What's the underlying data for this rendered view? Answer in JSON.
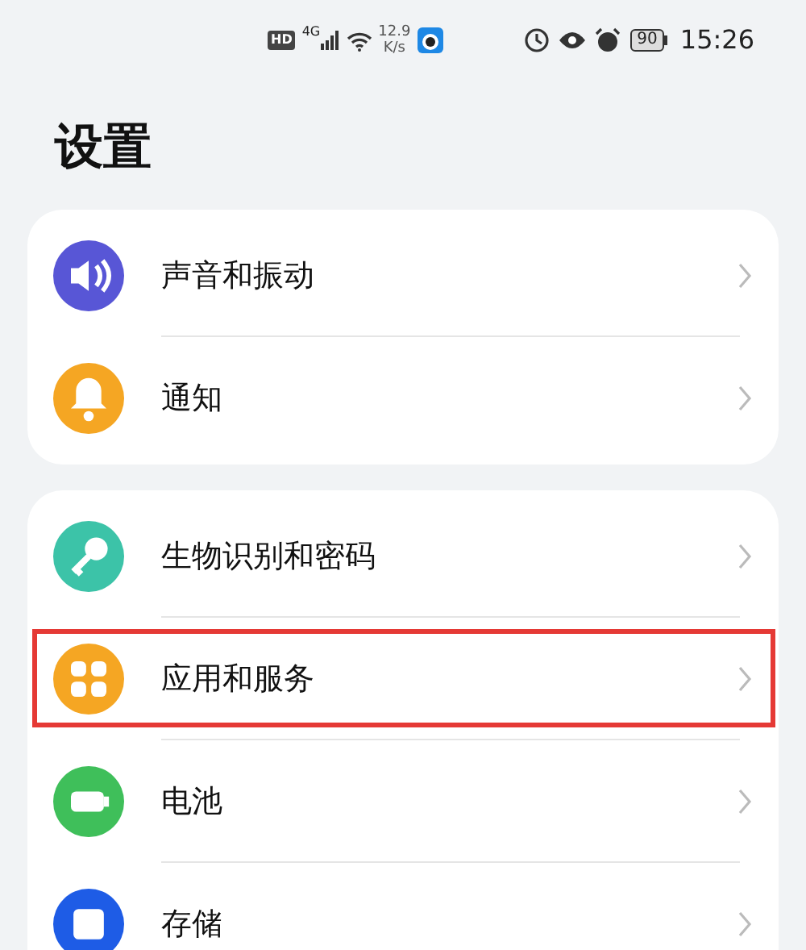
{
  "status_bar": {
    "hd": "HD",
    "network": "4G",
    "speed_value": "12.9",
    "speed_unit": "K/s",
    "battery": "90",
    "time": "15:26"
  },
  "title": "设置",
  "groups": [
    {
      "items": [
        {
          "label": "声音和振动",
          "kind": "sound",
          "color": "#5856d6",
          "highlighted": false
        },
        {
          "label": "通知",
          "kind": "bell",
          "color": "#f5a623",
          "highlighted": false
        }
      ]
    },
    {
      "items": [
        {
          "label": "生物识别和密码",
          "kind": "key",
          "color": "#3cc3a8",
          "highlighted": false
        },
        {
          "label": "应用和服务",
          "kind": "apps",
          "color": "#f5a623",
          "highlighted": true
        },
        {
          "label": "电池",
          "kind": "battery",
          "color": "#3fbf5a",
          "highlighted": false
        },
        {
          "label": "存储",
          "kind": "storage",
          "color": "#1e5ce6",
          "highlighted": false
        }
      ]
    }
  ]
}
